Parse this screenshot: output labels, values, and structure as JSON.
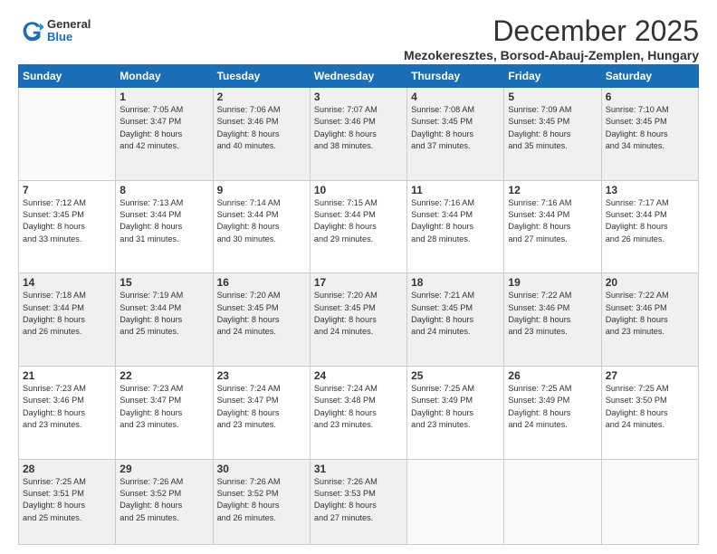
{
  "logo": {
    "general": "General",
    "blue": "Blue"
  },
  "header": {
    "month": "December 2025",
    "location": "Mezokeresztes, Borsod-Abauj-Zemplen, Hungary"
  },
  "weekdays": [
    "Sunday",
    "Monday",
    "Tuesday",
    "Wednesday",
    "Thursday",
    "Friday",
    "Saturday"
  ],
  "weeks": [
    [
      {
        "day": "",
        "text": ""
      },
      {
        "day": "1",
        "text": "Sunrise: 7:05 AM\nSunset: 3:47 PM\nDaylight: 8 hours\nand 42 minutes."
      },
      {
        "day": "2",
        "text": "Sunrise: 7:06 AM\nSunset: 3:46 PM\nDaylight: 8 hours\nand 40 minutes."
      },
      {
        "day": "3",
        "text": "Sunrise: 7:07 AM\nSunset: 3:46 PM\nDaylight: 8 hours\nand 38 minutes."
      },
      {
        "day": "4",
        "text": "Sunrise: 7:08 AM\nSunset: 3:45 PM\nDaylight: 8 hours\nand 37 minutes."
      },
      {
        "day": "5",
        "text": "Sunrise: 7:09 AM\nSunset: 3:45 PM\nDaylight: 8 hours\nand 35 minutes."
      },
      {
        "day": "6",
        "text": "Sunrise: 7:10 AM\nSunset: 3:45 PM\nDaylight: 8 hours\nand 34 minutes."
      }
    ],
    [
      {
        "day": "7",
        "text": "Sunrise: 7:12 AM\nSunset: 3:45 PM\nDaylight: 8 hours\nand 33 minutes."
      },
      {
        "day": "8",
        "text": "Sunrise: 7:13 AM\nSunset: 3:44 PM\nDaylight: 8 hours\nand 31 minutes."
      },
      {
        "day": "9",
        "text": "Sunrise: 7:14 AM\nSunset: 3:44 PM\nDaylight: 8 hours\nand 30 minutes."
      },
      {
        "day": "10",
        "text": "Sunrise: 7:15 AM\nSunset: 3:44 PM\nDaylight: 8 hours\nand 29 minutes."
      },
      {
        "day": "11",
        "text": "Sunrise: 7:16 AM\nSunset: 3:44 PM\nDaylight: 8 hours\nand 28 minutes."
      },
      {
        "day": "12",
        "text": "Sunrise: 7:16 AM\nSunset: 3:44 PM\nDaylight: 8 hours\nand 27 minutes."
      },
      {
        "day": "13",
        "text": "Sunrise: 7:17 AM\nSunset: 3:44 PM\nDaylight: 8 hours\nand 26 minutes."
      }
    ],
    [
      {
        "day": "14",
        "text": "Sunrise: 7:18 AM\nSunset: 3:44 PM\nDaylight: 8 hours\nand 26 minutes."
      },
      {
        "day": "15",
        "text": "Sunrise: 7:19 AM\nSunset: 3:44 PM\nDaylight: 8 hours\nand 25 minutes."
      },
      {
        "day": "16",
        "text": "Sunrise: 7:20 AM\nSunset: 3:45 PM\nDaylight: 8 hours\nand 24 minutes."
      },
      {
        "day": "17",
        "text": "Sunrise: 7:20 AM\nSunset: 3:45 PM\nDaylight: 8 hours\nand 24 minutes."
      },
      {
        "day": "18",
        "text": "Sunrise: 7:21 AM\nSunset: 3:45 PM\nDaylight: 8 hours\nand 24 minutes."
      },
      {
        "day": "19",
        "text": "Sunrise: 7:22 AM\nSunset: 3:46 PM\nDaylight: 8 hours\nand 23 minutes."
      },
      {
        "day": "20",
        "text": "Sunrise: 7:22 AM\nSunset: 3:46 PM\nDaylight: 8 hours\nand 23 minutes."
      }
    ],
    [
      {
        "day": "21",
        "text": "Sunrise: 7:23 AM\nSunset: 3:46 PM\nDaylight: 8 hours\nand 23 minutes."
      },
      {
        "day": "22",
        "text": "Sunrise: 7:23 AM\nSunset: 3:47 PM\nDaylight: 8 hours\nand 23 minutes."
      },
      {
        "day": "23",
        "text": "Sunrise: 7:24 AM\nSunset: 3:47 PM\nDaylight: 8 hours\nand 23 minutes."
      },
      {
        "day": "24",
        "text": "Sunrise: 7:24 AM\nSunset: 3:48 PM\nDaylight: 8 hours\nand 23 minutes."
      },
      {
        "day": "25",
        "text": "Sunrise: 7:25 AM\nSunset: 3:49 PM\nDaylight: 8 hours\nand 23 minutes."
      },
      {
        "day": "26",
        "text": "Sunrise: 7:25 AM\nSunset: 3:49 PM\nDaylight: 8 hours\nand 24 minutes."
      },
      {
        "day": "27",
        "text": "Sunrise: 7:25 AM\nSunset: 3:50 PM\nDaylight: 8 hours\nand 24 minutes."
      }
    ],
    [
      {
        "day": "28",
        "text": "Sunrise: 7:25 AM\nSunset: 3:51 PM\nDaylight: 8 hours\nand 25 minutes."
      },
      {
        "day": "29",
        "text": "Sunrise: 7:26 AM\nSunset: 3:52 PM\nDaylight: 8 hours\nand 25 minutes."
      },
      {
        "day": "30",
        "text": "Sunrise: 7:26 AM\nSunset: 3:52 PM\nDaylight: 8 hours\nand 26 minutes."
      },
      {
        "day": "31",
        "text": "Sunrise: 7:26 AM\nSunset: 3:53 PM\nDaylight: 8 hours\nand 27 minutes."
      },
      {
        "day": "",
        "text": ""
      },
      {
        "day": "",
        "text": ""
      },
      {
        "day": "",
        "text": ""
      }
    ]
  ]
}
